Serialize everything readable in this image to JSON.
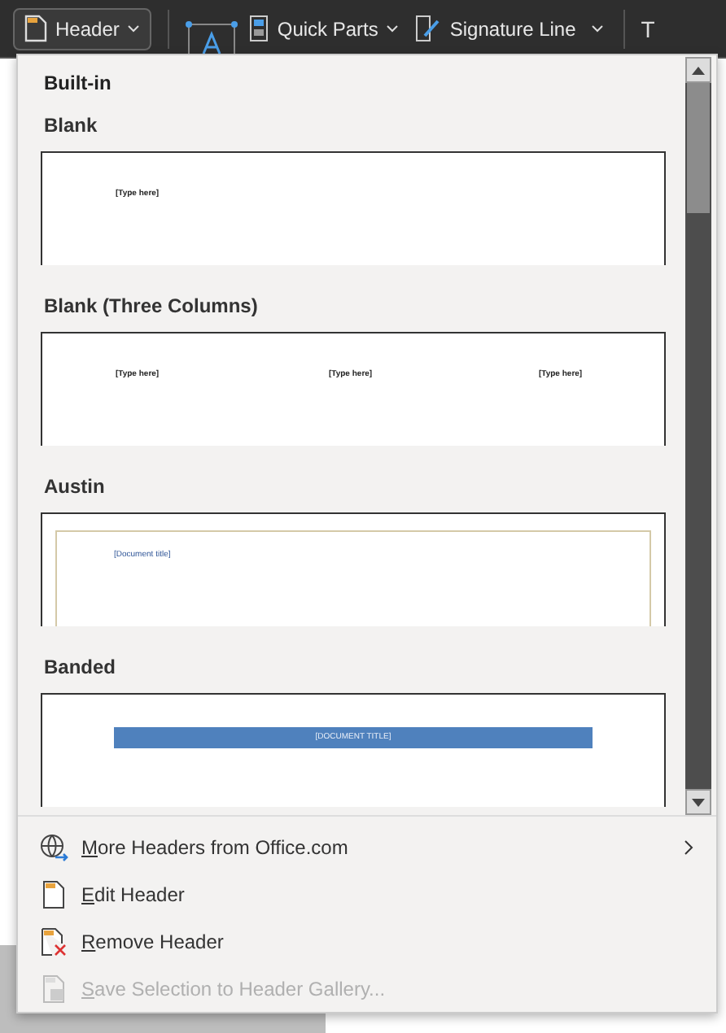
{
  "ribbon": {
    "header_button": {
      "label": "Header"
    },
    "quick_parts": {
      "label": "Quick Parts"
    },
    "signature_line": {
      "label": "Signature Line"
    },
    "edge_letter": "T"
  },
  "gallery": {
    "category": "Built-in",
    "items": [
      {
        "name": "Blank",
        "kind": "blank",
        "placeholders": [
          "[Type here]"
        ]
      },
      {
        "name": "Blank (Three Columns)",
        "kind": "three",
        "placeholders": [
          "[Type here]",
          "[Type here]",
          "[Type here]"
        ]
      },
      {
        "name": "Austin",
        "kind": "framed",
        "placeholders": [
          "[Document title]"
        ]
      },
      {
        "name": "Banded",
        "kind": "band",
        "placeholders": [
          "[DOCUMENT TITLE]"
        ]
      }
    ]
  },
  "menu": [
    {
      "key": "M",
      "rest": "ore Headers from Office.com",
      "kind": "globe",
      "submenu": true,
      "disabled": false
    },
    {
      "key": "E",
      "rest": "dit Header",
      "kind": "edit",
      "submenu": false,
      "disabled": false
    },
    {
      "key": "R",
      "rest": "emove Header",
      "kind": "remove",
      "submenu": false,
      "disabled": false
    },
    {
      "key": "S",
      "rest": "ave Selection to Header Gallery...",
      "kind": "save",
      "submenu": false,
      "disabled": true
    }
  ]
}
